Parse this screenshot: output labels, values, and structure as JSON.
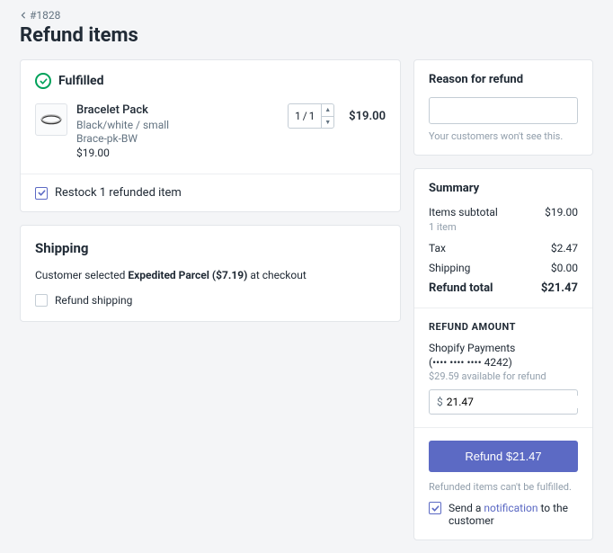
{
  "breadcrumb": {
    "order_number": "#1828"
  },
  "page_title": "Refund items",
  "fulfilled": {
    "label": "Fulfilled",
    "item": {
      "title": "Bracelet Pack",
      "variant": "Black/white / small",
      "sku": "Brace-pk-BW",
      "unit_price": "$19.00",
      "qty_current": "1",
      "qty_max": "1",
      "line_total": "$19.00"
    },
    "restock": {
      "checked": true,
      "label": "Restock 1 refunded item"
    }
  },
  "shipping": {
    "heading": "Shipping",
    "text_prefix": "Customer selected ",
    "method": "Expedited Parcel ($7.19)",
    "text_suffix": " at checkout",
    "refund_checkbox": {
      "checked": false,
      "label": "Refund shipping"
    }
  },
  "reason": {
    "heading": "Reason for refund",
    "value": "",
    "hint": "Your customers won't see this."
  },
  "summary": {
    "heading": "Summary",
    "rows": {
      "subtotal_label": "Items subtotal",
      "subtotal_value": "$19.00",
      "subtotal_count": "1 item",
      "tax_label": "Tax",
      "tax_value": "$2.47",
      "shipping_label": "Shipping",
      "shipping_value": "$0.00",
      "total_label": "Refund total",
      "total_value": "$21.47"
    }
  },
  "refund_amount": {
    "label": "REFUND AMOUNT",
    "gateway": "Shopify Payments",
    "masked_card": "(•••• •••• •••• 4242)",
    "available": "$29.59 available for refund",
    "currency_prefix": "$",
    "value": "21.47"
  },
  "action": {
    "button_label": "Refund $21.47",
    "note": "Refunded items can't be fulfilled.",
    "notify_checked": true,
    "notify_prefix": "Send a ",
    "notify_link": "notification",
    "notify_suffix": " to the customer"
  }
}
